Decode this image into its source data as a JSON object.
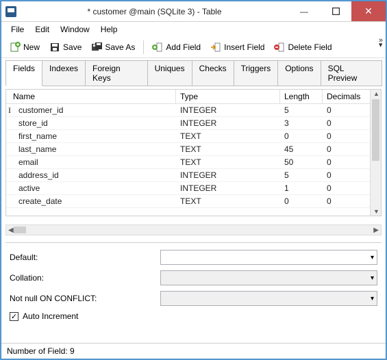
{
  "window": {
    "title": "* customer @main (SQLite 3) - Table"
  },
  "menu": {
    "file": "File",
    "edit": "Edit",
    "window": "Window",
    "help": "Help"
  },
  "toolbar": {
    "new": "New",
    "save": "Save",
    "saveas": "Save As",
    "addfield": "Add Field",
    "insertfield": "Insert Field",
    "deletefield": "Delete Field"
  },
  "tabs": {
    "fields": "Fields",
    "indexes": "Indexes",
    "fkeys": "Foreign Keys",
    "uniques": "Uniques",
    "checks": "Checks",
    "triggers": "Triggers",
    "options": "Options",
    "sqlpreview": "SQL Preview"
  },
  "columns": {
    "name": "Name",
    "type": "Type",
    "length": "Length",
    "decimals": "Decimals"
  },
  "rows": [
    {
      "name": "customer_id",
      "type": "INTEGER",
      "length": "5",
      "decimals": "0",
      "cursor": true
    },
    {
      "name": "store_id",
      "type": "INTEGER",
      "length": "3",
      "decimals": "0"
    },
    {
      "name": "first_name",
      "type": "TEXT",
      "length": "0",
      "decimals": "0"
    },
    {
      "name": "last_name",
      "type": "TEXT",
      "length": "45",
      "decimals": "0"
    },
    {
      "name": "email",
      "type": "TEXT",
      "length": "50",
      "decimals": "0"
    },
    {
      "name": "address_id",
      "type": "INTEGER",
      "length": "5",
      "decimals": "0"
    },
    {
      "name": "active",
      "type": "INTEGER",
      "length": "1",
      "decimals": "0"
    },
    {
      "name": "create_date",
      "type": "TEXT",
      "length": "0",
      "decimals": "0"
    }
  ],
  "form": {
    "default": "Default:",
    "collation": "Collation:",
    "notnull": "Not null ON CONFLICT:",
    "autoinc": "Auto Increment"
  },
  "status": {
    "text": "Number of Field: 9"
  }
}
